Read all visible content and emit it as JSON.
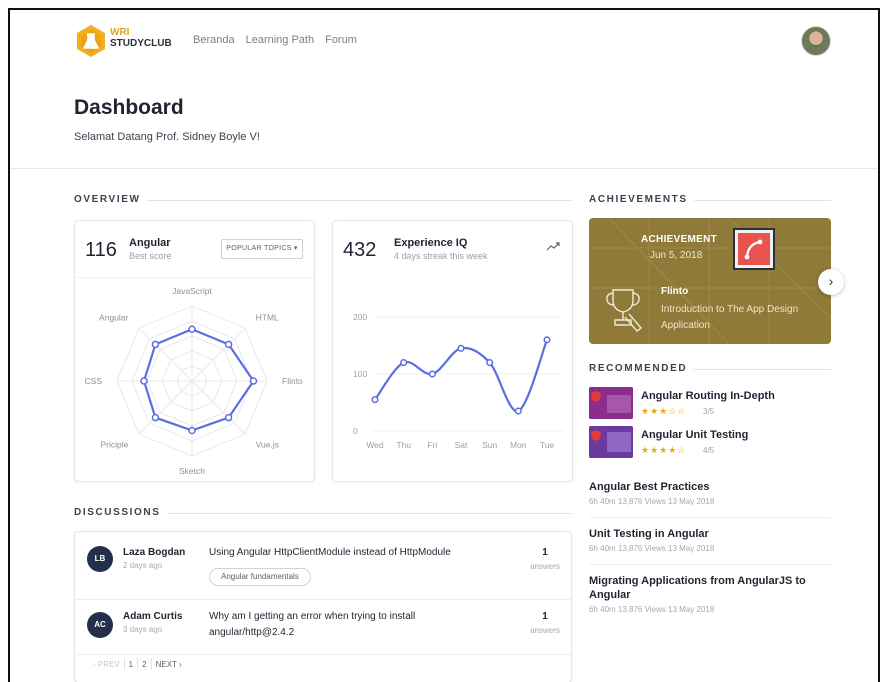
{
  "brand": {
    "line1": "WRI",
    "line2": "STUDYCLUB"
  },
  "nav": [
    "Beranda",
    "Learning Path",
    "Forum"
  ],
  "header": {
    "title": "Dashboard",
    "welcome": "Selamat Datang Prof. Sidney Boyle V!"
  },
  "sections": {
    "overview": "OVERVIEW",
    "achievements": "ACHIEVEMENTS",
    "recommended": "RECOMMENDED",
    "discussions": "DISCUSSIONS"
  },
  "radar_card": {
    "value": "116",
    "title": "Angular",
    "subtitle": "Best score",
    "dropdown": "POPULAR TOPICS ▾",
    "chart_data": {
      "type": "radar",
      "categories": [
        "JavaScript",
        "HTML",
        "Flinto",
        "Vue.js",
        "Sketch",
        "Priciple",
        "CSS",
        "Angular"
      ],
      "values": [
        0.69,
        0.69,
        0.82,
        0.69,
        0.66,
        0.69,
        0.64,
        0.69
      ],
      "color": "#5b6ee0"
    }
  },
  "line_card": {
    "value": "432",
    "title": "Experience IQ",
    "subtitle": "4 days streak this week",
    "chart_data": {
      "type": "line",
      "categories": [
        "Wed",
        "Thu",
        "Fri",
        "Sat",
        "Sun",
        "Mon",
        "Tue"
      ],
      "values": [
        55,
        120,
        100,
        145,
        120,
        35,
        160
      ],
      "yticks": [
        "0",
        "100",
        "200"
      ],
      "ylim": [
        0,
        200
      ],
      "color": "#5b6ee0"
    }
  },
  "achievement": {
    "label": "ACHIEVEMENT",
    "date": "Jun 5, 2018",
    "name": "Flinto",
    "description": "Introduction to The App Design Application"
  },
  "recommended": [
    {
      "title": "Angular Routing In-Depth",
      "stars": "★★★☆☆",
      "score": "3/5"
    },
    {
      "title": "Angular Unit Testing",
      "stars": "★★★★☆",
      "score": "4/5"
    }
  ],
  "courses": [
    {
      "title": "Angular Best Practices",
      "meta": "6h 40m   13,876 Views   13 May 2018"
    },
    {
      "title": "Unit Testing in Angular",
      "meta": "6h 40m   13,876 Views   13 May 2018"
    },
    {
      "title": "Migrating Applications from AngularJS to Angular",
      "meta": "6h 40m   13,876 Views   13 May 2018"
    }
  ],
  "discussions": [
    {
      "initials": "LB",
      "name": "Laza Bogdan",
      "time": "2 days ago",
      "text": "Using Angular HttpClientModule instead of HttpModule",
      "tag": "Angular fundamentals",
      "count": "1",
      "answers": "answers"
    },
    {
      "initials": "AC",
      "name": "Adam Curtis",
      "time": "3 days ago",
      "text": "Why am I getting an error when trying to install angular/http@2.4.2",
      "count": "1",
      "answers": "answers"
    }
  ],
  "pager": {
    "prev": "‹ PREV",
    "pages": [
      "1",
      "2"
    ],
    "next": "NEXT ›"
  }
}
